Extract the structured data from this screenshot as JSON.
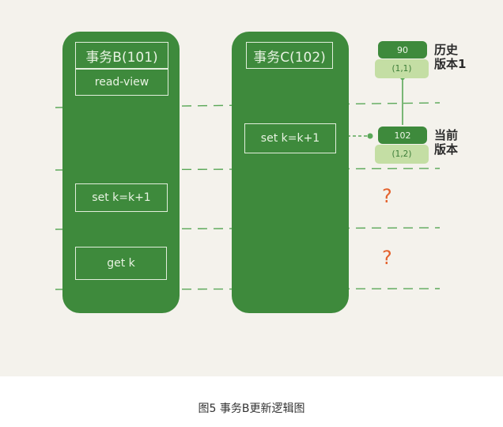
{
  "transaction_b": {
    "title": "事务B(101)",
    "read_view": "read-view",
    "step_set": "set k=k+1",
    "step_get": "get k"
  },
  "transaction_c": {
    "title": "事务C(102)",
    "step_set": "set k=k+1"
  },
  "version_history": {
    "value": "90",
    "trx": "(1,1)",
    "label_line1": "历史",
    "label_line2": "版本1"
  },
  "version_current": {
    "value": "102",
    "trx": "(1,2)",
    "label_line1": "当前",
    "label_line2": "版本"
  },
  "unknown_marks": [
    "?",
    "?"
  ],
  "caption": "图5 事务B更新逻辑图",
  "colors": {
    "panel": "#3e8a3c",
    "light_green": "#c4dea4",
    "dashed_line": "#5aa858",
    "arrow": "#5aa858",
    "question": "#e4622d"
  }
}
